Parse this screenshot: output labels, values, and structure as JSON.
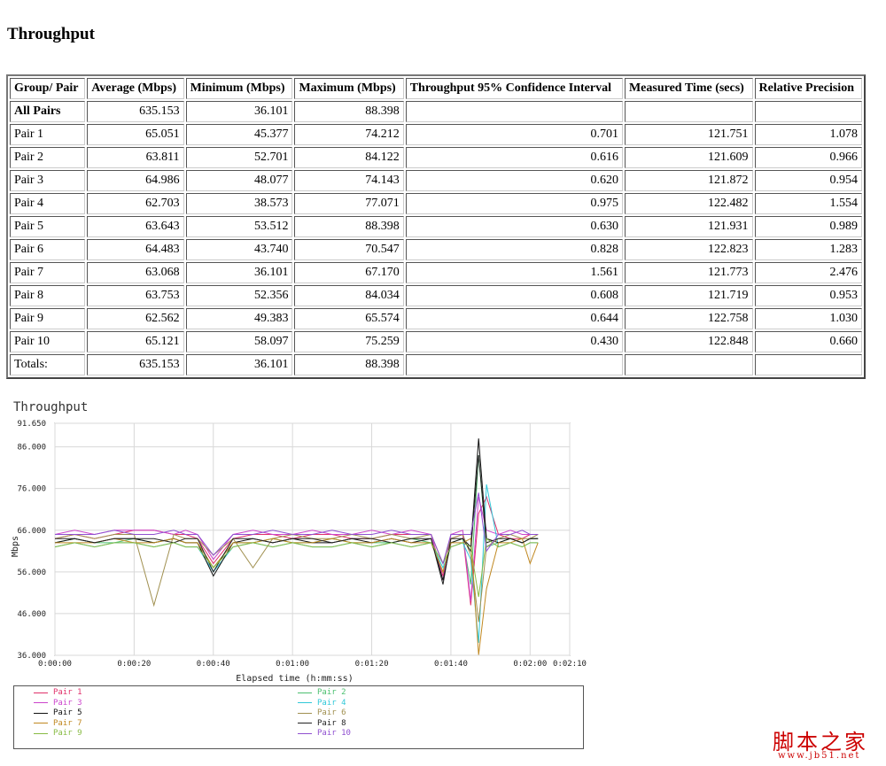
{
  "page": {
    "heading": "Throughput"
  },
  "table": {
    "headers": [
      "Group/ Pair",
      "Average (Mbps)",
      "Minimum (Mbps)",
      "Maximum (Mbps)",
      "Throughput 95% Confidence Interval",
      "Measured Time (secs)",
      "Relative Precision"
    ],
    "rows": [
      [
        "All Pairs",
        "635.153",
        "36.101",
        "88.398",
        "",
        "",
        ""
      ],
      [
        "Pair 1",
        "65.051",
        "45.377",
        "74.212",
        "0.701",
        "121.751",
        "1.078"
      ],
      [
        "Pair 2",
        "63.811",
        "52.701",
        "84.122",
        "0.616",
        "121.609",
        "0.966"
      ],
      [
        "Pair 3",
        "64.986",
        "48.077",
        "74.143",
        "0.620",
        "121.872",
        "0.954"
      ],
      [
        "Pair 4",
        "62.703",
        "38.573",
        "77.071",
        "0.975",
        "122.482",
        "1.554"
      ],
      [
        "Pair 5",
        "63.643",
        "53.512",
        "88.398",
        "0.630",
        "121.931",
        "0.989"
      ],
      [
        "Pair 6",
        "64.483",
        "43.740",
        "70.547",
        "0.828",
        "122.823",
        "1.283"
      ],
      [
        "Pair 7",
        "63.068",
        "36.101",
        "67.170",
        "1.561",
        "121.773",
        "2.476"
      ],
      [
        "Pair 8",
        "63.753",
        "52.356",
        "84.034",
        "0.608",
        "121.719",
        "0.953"
      ],
      [
        "Pair 9",
        "62.562",
        "49.383",
        "65.574",
        "0.644",
        "122.758",
        "1.030"
      ],
      [
        "Pair 10",
        "65.121",
        "58.097",
        "75.259",
        "0.430",
        "122.848",
        "0.660"
      ],
      [
        "Totals:",
        "635.153",
        "36.101",
        "88.398",
        "",
        "",
        ""
      ]
    ]
  },
  "chart_data": {
    "type": "line",
    "title": "Throughput",
    "xlabel": "Elapsed time (h:mm:ss)",
    "ylabel": "Mbps",
    "xlim": [
      0,
      130
    ],
    "ylim": [
      36,
      91.65
    ],
    "x_ticks": [
      0,
      20,
      40,
      60,
      80,
      100,
      120,
      130
    ],
    "x_tick_labels": [
      "0:00:00",
      "0:00:20",
      "0:00:40",
      "0:01:00",
      "0:01:20",
      "0:01:40",
      "0:02:00",
      "0:02:10"
    ],
    "y_ticks": [
      36,
      46,
      56,
      66,
      76,
      86,
      91.65
    ],
    "y_tick_labels": [
      "36.000",
      "46.000",
      "56.000",
      "66.000",
      "76.000",
      "86.000",
      "91.650"
    ],
    "grid": true,
    "legend_position": "bottom",
    "series": [
      {
        "name": "Pair 1",
        "color": "#e0306a",
        "x": [
          0,
          5,
          10,
          15,
          20,
          25,
          30,
          33,
          36,
          40,
          45,
          50,
          55,
          60,
          65,
          70,
          75,
          80,
          85,
          90,
          95,
          98,
          100,
          103,
          105,
          107,
          109,
          112,
          115,
          118,
          120,
          122
        ],
        "y": [
          64,
          65,
          64,
          65,
          66,
          66,
          65,
          65,
          64,
          58,
          64,
          65,
          65,
          64,
          65,
          65,
          64,
          64,
          65,
          65,
          65,
          55,
          64,
          65,
          48,
          70,
          74,
          65,
          64,
          64,
          65,
          65
        ]
      },
      {
        "name": "Pair 2",
        "color": "#4cc070",
        "x": [
          0,
          5,
          10,
          15,
          20,
          25,
          30,
          33,
          36,
          40,
          45,
          50,
          55,
          60,
          65,
          70,
          75,
          80,
          85,
          90,
          95,
          98,
          100,
          103,
          105,
          107,
          109,
          112,
          115,
          118,
          120,
          122
        ],
        "y": [
          63,
          64,
          63,
          63,
          64,
          63,
          64,
          63,
          63,
          57,
          63,
          63,
          64,
          63,
          63,
          64,
          63,
          63,
          63,
          64,
          63,
          56,
          63,
          64,
          53,
          84,
          62,
          63,
          64,
          63,
          64,
          64
        ]
      },
      {
        "name": "Pair 3",
        "color": "#cc44cc",
        "x": [
          0,
          5,
          10,
          15,
          20,
          25,
          30,
          33,
          36,
          40,
          45,
          50,
          55,
          60,
          65,
          70,
          75,
          80,
          85,
          90,
          95,
          98,
          100,
          103,
          105,
          107,
          109,
          112,
          115,
          118,
          120,
          122
        ],
        "y": [
          65,
          66,
          65,
          66,
          66,
          66,
          65,
          66,
          65,
          59,
          65,
          66,
          65,
          65,
          66,
          65,
          65,
          66,
          65,
          66,
          65,
          54,
          65,
          66,
          49,
          74,
          66,
          65,
          66,
          65,
          65,
          65
        ]
      },
      {
        "name": "Pair 4",
        "color": "#30c8d8",
        "x": [
          0,
          5,
          10,
          15,
          20,
          25,
          30,
          33,
          36,
          40,
          45,
          50,
          55,
          60,
          65,
          70,
          75,
          80,
          85,
          90,
          95,
          98,
          100,
          103,
          105,
          107,
          109,
          112,
          115,
          118,
          120,
          122
        ],
        "y": [
          62,
          63,
          62,
          63,
          63,
          62,
          63,
          62,
          62,
          56,
          62,
          63,
          62,
          63,
          62,
          62,
          63,
          62,
          63,
          62,
          63,
          57,
          62,
          63,
          59,
          39,
          77,
          62,
          63,
          62,
          63,
          63
        ]
      },
      {
        "name": "Pair 5",
        "color": "#111111",
        "x": [
          0,
          5,
          10,
          15,
          20,
          25,
          30,
          33,
          36,
          40,
          45,
          50,
          55,
          60,
          65,
          70,
          75,
          80,
          85,
          90,
          95,
          98,
          100,
          103,
          105,
          107,
          109,
          112,
          115,
          118,
          120,
          122
        ],
        "y": [
          63,
          64,
          63,
          64,
          64,
          63,
          64,
          63,
          63,
          55,
          63,
          64,
          63,
          64,
          63,
          63,
          64,
          63,
          64,
          63,
          64,
          54,
          63,
          64,
          62,
          88,
          64,
          63,
          64,
          63,
          64,
          64
        ]
      },
      {
        "name": "Pair 6",
        "color": "#a09050",
        "x": [
          0,
          5,
          10,
          15,
          20,
          25,
          30,
          33,
          36,
          40,
          45,
          50,
          55,
          60,
          65,
          70,
          75,
          80,
          85,
          90,
          95,
          98,
          100,
          103,
          105,
          107,
          109,
          112,
          115,
          118,
          120,
          122
        ],
        "y": [
          64,
          65,
          64,
          65,
          65,
          48,
          65,
          64,
          64,
          60,
          64,
          57,
          64,
          65,
          64,
          64,
          65,
          64,
          65,
          64,
          65,
          58,
          64,
          65,
          60,
          44,
          62,
          64,
          65,
          64,
          64,
          65
        ]
      },
      {
        "name": "Pair 7",
        "color": "#c08820",
        "x": [
          0,
          5,
          10,
          15,
          20,
          25,
          30,
          33,
          36,
          40,
          45,
          50,
          55,
          60,
          65,
          70,
          75,
          80,
          85,
          90,
          95,
          98,
          100,
          103,
          105,
          107,
          109,
          112,
          115,
          118,
          120,
          122
        ],
        "y": [
          63,
          63,
          63,
          64,
          63,
          63,
          64,
          63,
          63,
          57,
          63,
          63,
          64,
          63,
          63,
          64,
          63,
          63,
          64,
          63,
          63,
          56,
          63,
          63,
          64,
          36.1,
          52,
          63,
          63,
          64,
          58,
          63
        ]
      },
      {
        "name": "Pair 8",
        "color": "#222222",
        "x": [
          0,
          5,
          10,
          15,
          20,
          25,
          30,
          33,
          36,
          40,
          45,
          50,
          55,
          60,
          65,
          70,
          75,
          80,
          85,
          90,
          95,
          98,
          100,
          103,
          105,
          107,
          109,
          112,
          115,
          118,
          120,
          122
        ],
        "y": [
          64,
          64,
          63,
          64,
          64,
          64,
          63,
          64,
          64,
          56,
          64,
          64,
          63,
          64,
          64,
          63,
          64,
          64,
          63,
          64,
          64,
          53,
          64,
          64,
          61,
          84,
          63,
          64,
          64,
          63,
          64,
          64
        ]
      },
      {
        "name": "Pair 9",
        "color": "#88bb44",
        "x": [
          0,
          5,
          10,
          15,
          20,
          25,
          30,
          33,
          36,
          40,
          45,
          50,
          55,
          60,
          65,
          70,
          75,
          80,
          85,
          90,
          95,
          98,
          100,
          103,
          105,
          107,
          109,
          112,
          115,
          118,
          120,
          122
        ],
        "y": [
          62,
          63,
          62,
          63,
          63,
          62,
          63,
          62,
          62,
          57,
          62,
          63,
          62,
          63,
          62,
          62,
          63,
          62,
          63,
          62,
          63,
          58,
          62,
          63,
          62,
          50,
          64,
          62,
          63,
          62,
          63,
          63
        ]
      },
      {
        "name": "Pair 10",
        "color": "#9050d0",
        "x": [
          0,
          5,
          10,
          15,
          20,
          25,
          30,
          33,
          36,
          40,
          45,
          50,
          55,
          60,
          65,
          70,
          75,
          80,
          85,
          90,
          95,
          98,
          100,
          103,
          105,
          107,
          109,
          112,
          115,
          118,
          120,
          122
        ],
        "y": [
          65,
          65,
          65,
          66,
          65,
          65,
          66,
          65,
          65,
          60,
          65,
          65,
          66,
          65,
          65,
          66,
          65,
          65,
          66,
          65,
          65,
          58,
          65,
          65,
          65,
          75,
          61,
          65,
          65,
          66,
          65,
          65
        ]
      }
    ]
  },
  "legend": {
    "left": [
      "Pair 1",
      "Pair 3",
      "Pair 5",
      "Pair 7",
      "Pair 9"
    ],
    "right": [
      "Pair 2",
      "Pair 4",
      "Pair 6",
      "Pair 8",
      "Pair 10"
    ]
  },
  "watermark": {
    "big": "脚本之家",
    "small": "www.jb51.net"
  }
}
